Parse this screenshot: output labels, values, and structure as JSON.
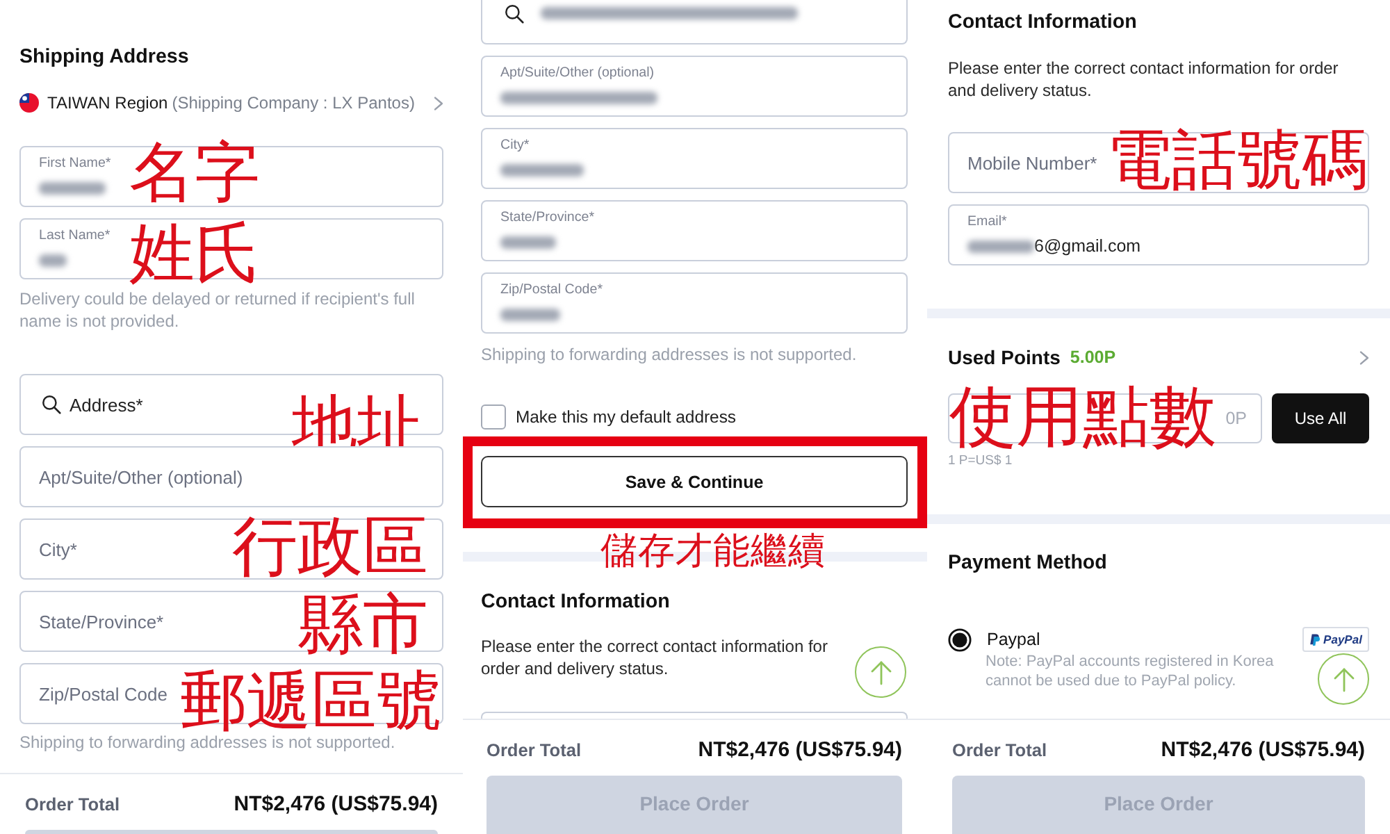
{
  "panels": [
    {
      "blocks": [
        {
          "kind": "heading",
          "text": "Shipping Address"
        },
        {
          "kind": "region",
          "region": "TAIWAN Region",
          "carrier": "(Shipping Company : LX Pantos)"
        },
        {
          "kind": "field",
          "label": "First Name*",
          "blurred": true,
          "annotation": "名字"
        },
        {
          "kind": "field",
          "label": "Last Name*",
          "blurred": true,
          "annotation": "姓氏"
        },
        {
          "kind": "note",
          "text": "Delivery could be delayed or returned if recipient's full name is not provided."
        },
        {
          "kind": "field",
          "placeholder": "Address*",
          "search": true,
          "annotation": "地址"
        },
        {
          "kind": "field",
          "placeholder": "Apt/Suite/Other (optional)"
        },
        {
          "kind": "field",
          "placeholder": "City*",
          "annotation": "行政區"
        },
        {
          "kind": "field",
          "placeholder": "State/Province*",
          "annotation": "縣市"
        },
        {
          "kind": "field",
          "placeholder": "Zip/Postal Code",
          "annotation": "郵遞區號"
        },
        {
          "kind": "note",
          "text": "Shipping to forwarding addresses is not supported."
        }
      ],
      "footer": {
        "label": "Order Total",
        "amount": "NT$2,476 (US$75.94)",
        "button": {
          "disabled": true
        }
      }
    },
    {
      "blocks": [
        {
          "kind": "topfield",
          "search": true,
          "blurred": true
        },
        {
          "kind": "field",
          "label": "Apt/Suite/Other (optional)",
          "blurred": true
        },
        {
          "kind": "field",
          "label": "City*",
          "blurred": true
        },
        {
          "kind": "field",
          "label": "State/Province*",
          "blurred": true
        },
        {
          "kind": "field",
          "label": "Zip/Postal Code*",
          "blurred": true
        },
        {
          "kind": "note",
          "text": "Shipping to forwarding addresses is not supported."
        },
        {
          "kind": "checkbox",
          "label": "Make this my default address",
          "checked": false
        },
        {
          "kind": "button",
          "label": "Save & Continue",
          "highlighted": true,
          "annotation": "儲存才能繼續"
        },
        {
          "kind": "band"
        },
        {
          "kind": "heading",
          "text": "Contact Information"
        },
        {
          "kind": "text",
          "text": "Please enter the correct contact information for order and delivery status."
        },
        {
          "kind": "stubfield"
        }
      ],
      "scroll_top_button": true,
      "footer": {
        "label": "Order Total",
        "amount": "NT$2,476 (US$75.94)",
        "button": {
          "label": "Place Order",
          "disabled": true
        }
      }
    },
    {
      "blocks": [
        {
          "kind": "heading",
          "text": "Contact Information"
        },
        {
          "kind": "text",
          "text": "Please enter the correct contact information for order and delivery status."
        },
        {
          "kind": "field",
          "placeholder": "Mobile Number*",
          "annotation": "電話號碼"
        },
        {
          "kind": "field",
          "label": "Email*",
          "blurred": true,
          "value": "6@gmail.com"
        },
        {
          "kind": "band"
        },
        {
          "kind": "expander",
          "text": "Used Points",
          "points": "5.00P"
        },
        {
          "kind": "points",
          "placeholder": "0P",
          "button": "Use All",
          "annotation": "使用點數"
        },
        {
          "kind": "caption",
          "text": "1 P=US$ 1"
        },
        {
          "kind": "band"
        },
        {
          "kind": "heading",
          "text": "Payment Method"
        },
        {
          "kind": "radio",
          "label": "Paypal",
          "selected": true,
          "logo": "PayPal",
          "note": "Note: PayPal accounts registered in Korea cannot be used due to PayPal policy."
        }
      ],
      "scroll_top_button": true,
      "footer": {
        "label": "Order Total",
        "amount": "NT$2,476 (US$75.94)",
        "button": {
          "label": "Place Order",
          "disabled": true
        }
      }
    }
  ]
}
